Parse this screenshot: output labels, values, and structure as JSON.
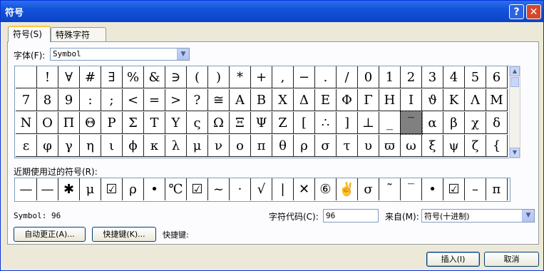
{
  "window": {
    "title": "符号"
  },
  "tabs": [
    {
      "label": "符号(S)"
    },
    {
      "label": "特殊字符(P)"
    }
  ],
  "font": {
    "label": "字体(F):",
    "value": "Symbol"
  },
  "grid_rows": [
    [
      "",
      "!",
      "∀",
      "#",
      "∃",
      "%",
      "&",
      "∋",
      "(",
      ")",
      "*",
      "+",
      ",",
      "−",
      ".",
      "/",
      "0",
      "1",
      "2",
      "3",
      "4",
      "5",
      "6"
    ],
    [
      "7",
      "8",
      "9",
      ":",
      ";",
      "<",
      "=",
      ">",
      "?",
      "≅",
      "Α",
      "Β",
      "Χ",
      "Δ",
      "Ε",
      "Φ",
      "Γ",
      "Η",
      "Ι",
      "ϑ",
      "Κ",
      "Λ",
      "Μ"
    ],
    [
      "Ν",
      "Ο",
      "Π",
      "Θ",
      "Ρ",
      "Σ",
      "Τ",
      "Υ",
      "ς",
      "Ω",
      "Ξ",
      "Ψ",
      "Ζ",
      "[",
      "∴",
      "]",
      "⊥",
      "_",
      "‾",
      "α",
      "β",
      "χ",
      "δ"
    ],
    [
      "ε",
      "φ",
      "γ",
      "η",
      "ι",
      "ϕ",
      "κ",
      "λ",
      "μ",
      "ν",
      "ο",
      "π",
      "θ",
      "ρ",
      "σ",
      "τ",
      "υ",
      "ϖ",
      "ω",
      "ξ",
      "ψ",
      "ζ",
      "{"
    ]
  ],
  "recent": {
    "label": "近期使用过的符号(R):",
    "symbols": [
      "—",
      "—",
      "✱",
      "μ",
      "☑",
      "ρ",
      "•",
      "℃",
      "☑",
      "~",
      "·",
      "√",
      "|",
      "✕",
      "⑥",
      "✌",
      "σ",
      "˜",
      "‾",
      "•",
      "☑",
      "–",
      "п"
    ]
  },
  "status": {
    "symbol_info": "Symbol: 96",
    "code_label": "字符代码(C):",
    "code_value": "96",
    "from_label": "来自(M):",
    "from_value": "符号(十进制)"
  },
  "buttons": {
    "autocorrect": "自动更正(A)...",
    "shortcut": "快捷键(K)...",
    "shortcut_label": "快捷键:",
    "insert": "插入(I)",
    "cancel": "取消"
  }
}
